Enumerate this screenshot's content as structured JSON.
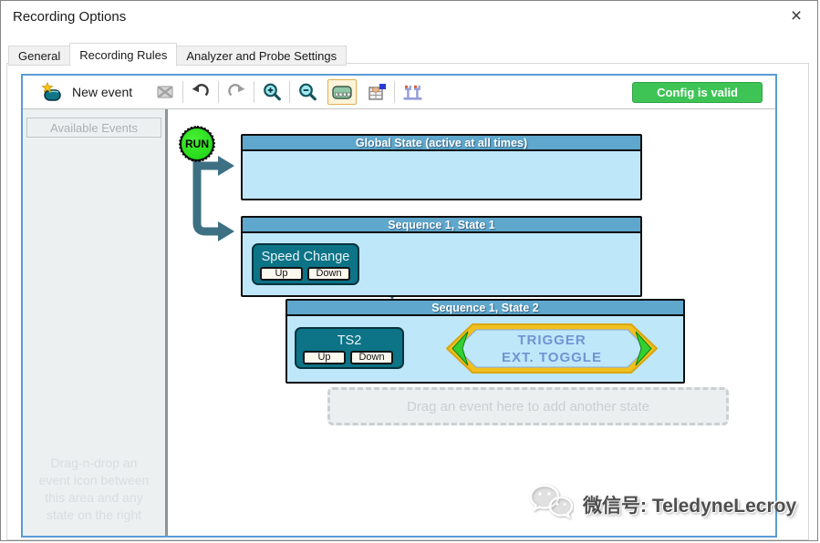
{
  "window": {
    "title": "Recording Options",
    "close_glyph": "×"
  },
  "tabs": [
    {
      "label": "General"
    },
    {
      "label": "Recording Rules"
    },
    {
      "label": "Analyzer and Probe Settings"
    }
  ],
  "active_tab": "Recording Rules",
  "toolbar": {
    "new_event_label": "New event",
    "status_label": "Config is valid",
    "icons": [
      "new-event-icon",
      "delete-event-icon",
      "undo-icon",
      "redo-icon",
      "zoom-in-icon",
      "zoom-out-icon",
      "front-panel-icon",
      "properties-icon",
      "probes-icon"
    ]
  },
  "left_panel": {
    "header": "Available Events",
    "hint_lines": [
      "Drag-n-drop an",
      "event icon between",
      "this area and any",
      "state on the right"
    ]
  },
  "diagram": {
    "run_label": "RUN",
    "global_state": {
      "title": "Global State (active at all times)"
    },
    "state1": {
      "title": "Sequence 1, State 1",
      "event": {
        "name": "Speed Change",
        "button_up": "Up",
        "button_down": "Down"
      }
    },
    "state2": {
      "title": "Sequence 1, State 2",
      "event": {
        "name": "TS2",
        "button_up": "Up",
        "button_down": "Down"
      },
      "action": {
        "line1": "TRIGGER",
        "line2": "EXT. TOGGLE"
      }
    },
    "drop_hint": "Drag an event here to add another state"
  },
  "watermark": {
    "text": "微信号: TeledyneLecroy"
  },
  "colors": {
    "panel_border": "#5B9BD5",
    "status_green": "#3EC455",
    "state_header_blue": "#5FA7CC",
    "state_body_blue": "#BFE7FA",
    "event_teal": "#0D7386",
    "arrow_teal": "#3E7083",
    "hexagon_gold": "#EFC01F",
    "trigger_text_blue": "#6F94D4",
    "run_green": "#17D210"
  }
}
